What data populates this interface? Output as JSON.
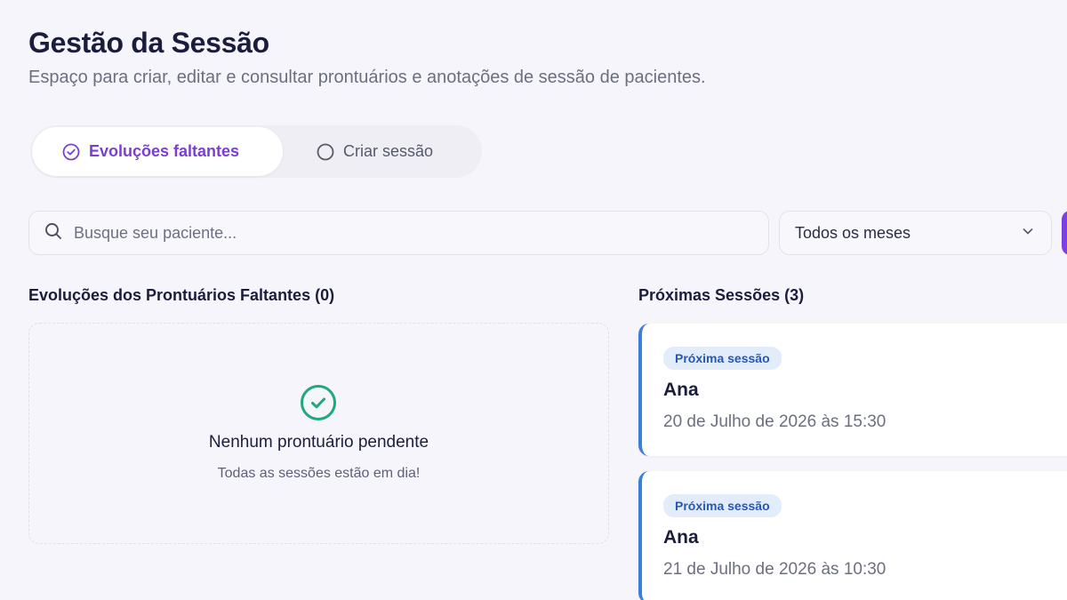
{
  "header": {
    "title": "Gestão da Sessão",
    "subtitle": "Espaço para criar, editar e consultar prontuários e anotações de sessão de pacientes."
  },
  "tabs": [
    {
      "label": "Evoluções faltantes",
      "active": true,
      "icon": "check-circle-icon"
    },
    {
      "label": "Criar sessão",
      "active": false,
      "icon": "circle-icon"
    }
  ],
  "search": {
    "placeholder": "Busque seu paciente...",
    "value": "",
    "icon": "search-icon"
  },
  "month_filter": {
    "selected": "Todos os meses",
    "icon": "chevron-down-icon"
  },
  "missing_section": {
    "title": "Evoluções dos Prontuários Faltantes (0)",
    "empty_title": "Nenhum prontuário pendente",
    "empty_subtitle": "Todas as sessões estão em dia!",
    "icon": "check-circle-icon"
  },
  "upcoming_section": {
    "title": "Próximas Sessões (3)",
    "sessions": [
      {
        "badge": "Próxima sessão",
        "name": "Ana",
        "datetime": "20 de Julho de 2026 às 15:30"
      },
      {
        "badge": "Próxima sessão",
        "name": "Ana",
        "datetime": "21 de Julho de 2026 às 10:30"
      }
    ]
  },
  "colors": {
    "accent": "#7a3fd0",
    "success": "#1fa87a",
    "session_border": "#3a7fdc",
    "badge_bg": "#e3ecfb",
    "badge_text": "#2457b8",
    "background": "#f6f5fb"
  }
}
